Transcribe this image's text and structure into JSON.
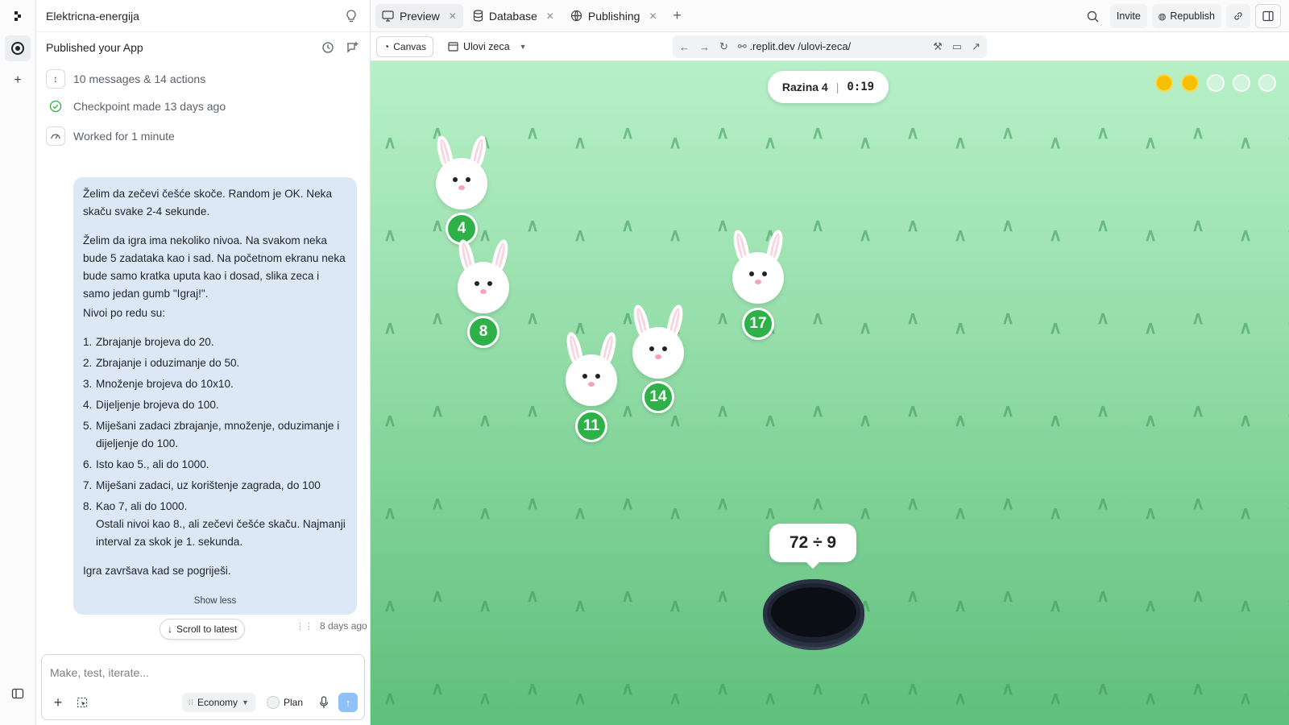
{
  "rail": {
    "icons": [
      "replit-logo-icon",
      "agent-icon",
      "plus-icon",
      "sidebar-toggle-icon"
    ]
  },
  "chat": {
    "project_name": "Elektricna-energija",
    "header_title": "Published your App",
    "meta": {
      "messages": "10 messages & 14 actions",
      "checkpoint": "Checkpoint made 13 days ago",
      "worked": "Worked for 1 minute"
    },
    "message": {
      "p1": "Želim da zečevi češće skoče. Random je OK. Neka skaču svake 2-4 sekunde.",
      "p2": "Želim da igra ima nekoliko nivoa. Na svakom neka bude 5 zadataka kao i sad. Na početnom ekranu neka bude samo kratka uputa kao i dosad, slika zeca i samo jedan gumb \"Igraj!\".",
      "p2b": "Nivoi po redu su:",
      "levels": [
        {
          "n": "1.",
          "text": "Zbrajanje brojeva do 20."
        },
        {
          "n": "2.",
          "text": "Zbrajanje i oduzimanje do 50."
        },
        {
          "n": "3.",
          "text": "Množenje brojeva do 10x10."
        },
        {
          "n": "4.",
          "text": "Dijeljenje brojeva do 100."
        },
        {
          "n": "5.",
          "text": "Miješani zadaci zbrajanje, množenje, oduzimanje i dijeljenje do 100."
        },
        {
          "n": "6.",
          "text": "Isto kao 5., ali do 1000."
        },
        {
          "n": "7.",
          "text": "Miješani zadaci, uz korištenje zagrada, do 100"
        },
        {
          "n": "8.",
          "text": "Kao 7, ali do 1000."
        }
      ],
      "extra": "Ostali nivoi kao 8., ali zečevi češće skaču. Najmanji interval za skok je 1. sekunda.",
      "p3": "Igra završava kad se pogriješi.",
      "show_less": "Show less"
    },
    "scroll_latest": "Scroll to latest",
    "timestamp": "8 days ago",
    "composer": {
      "placeholder": "Make, test, iterate...",
      "mode": "Economy",
      "plan": "Plan"
    }
  },
  "tabs": [
    {
      "label": "Preview",
      "icon": "monitor-icon",
      "active": true
    },
    {
      "label": "Database",
      "icon": "database-icon",
      "active": false
    },
    {
      "label": "Publishing",
      "icon": "globe-icon",
      "active": false
    }
  ],
  "top_right": {
    "invite": "Invite",
    "republish": "Republish"
  },
  "preview": {
    "canvas": "Canvas",
    "app_name": "Ulovi zeca",
    "url": ".replit.dev /ulovi-zeca/"
  },
  "game": {
    "level": "Razina 4",
    "time": "0:19",
    "progress": {
      "done": 2,
      "total": 5
    },
    "problem": "72 ÷ 9",
    "bunnies": [
      {
        "value": "4"
      },
      {
        "value": "8"
      },
      {
        "value": "11"
      },
      {
        "value": "14"
      },
      {
        "value": "17"
      }
    ],
    "colors": {
      "badge": "#2fb14a",
      "progress_on": "#f6c000"
    }
  }
}
